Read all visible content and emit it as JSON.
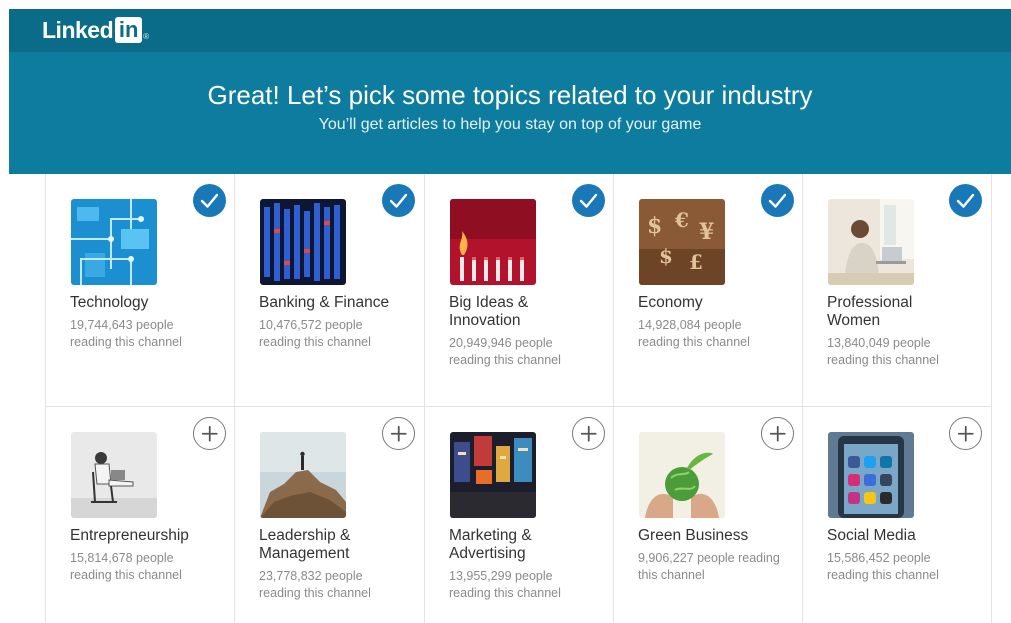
{
  "app": {
    "logo_text": "Linked",
    "logo_box": "in",
    "logo_reg": "®"
  },
  "hero": {
    "title": "Great! Let’s pick some topics related to your industry",
    "subtitle": "You’ll get articles to help you stay on top of your game"
  },
  "colors": {
    "header": "#0e7c9e",
    "brand_bar": "#0b6c8a",
    "selected": "#1a78b8"
  },
  "topics": [
    {
      "title_l1": "Technology",
      "title_l2": "",
      "meta_l1": "19,744,643 people",
      "meta_l2": "reading this channel",
      "selected": true,
      "icon": "checkmark-icon"
    },
    {
      "title_l1": "Banking & Finance",
      "title_l2": "",
      "meta_l1": "10,476,572 people",
      "meta_l2": "reading this channel",
      "selected": true,
      "icon": "checkmark-icon"
    },
    {
      "title_l1": "Big Ideas &",
      "title_l2": "Innovation",
      "meta_l1": "20,949,946 people",
      "meta_l2": "reading this channel",
      "selected": true,
      "icon": "checkmark-icon"
    },
    {
      "title_l1": "Economy",
      "title_l2": "",
      "meta_l1": "14,928,084 people",
      "meta_l2": "reading this channel",
      "selected": true,
      "icon": "checkmark-icon"
    },
    {
      "title_l1": "Professional",
      "title_l2": "Women",
      "meta_l1": "13,840,049 people",
      "meta_l2": "reading this channel",
      "selected": true,
      "icon": "checkmark-icon"
    },
    {
      "title_l1": "Entrepreneurship",
      "title_l2": "",
      "meta_l1": "15,814,678 people",
      "meta_l2": "reading this channel",
      "selected": false,
      "icon": "plus-icon"
    },
    {
      "title_l1": "Leadership &",
      "title_l2": "Management",
      "meta_l1": "23,778,832 people",
      "meta_l2": "reading this channel",
      "selected": false,
      "icon": "plus-icon"
    },
    {
      "title_l1": "Marketing &",
      "title_l2": "Advertising",
      "meta_l1": "13,955,299 people",
      "meta_l2": "reading this channel",
      "selected": false,
      "icon": "plus-icon"
    },
    {
      "title_l1": "Green Business",
      "title_l2": "",
      "meta_l1": "9,906,227 people reading",
      "meta_l2": "this channel",
      "selected": false,
      "icon": "plus-icon"
    },
    {
      "title_l1": "Social Media",
      "title_l2": "",
      "meta_l1": "15,586,452 people",
      "meta_l2": "reading this channel",
      "selected": false,
      "icon": "plus-icon"
    }
  ]
}
